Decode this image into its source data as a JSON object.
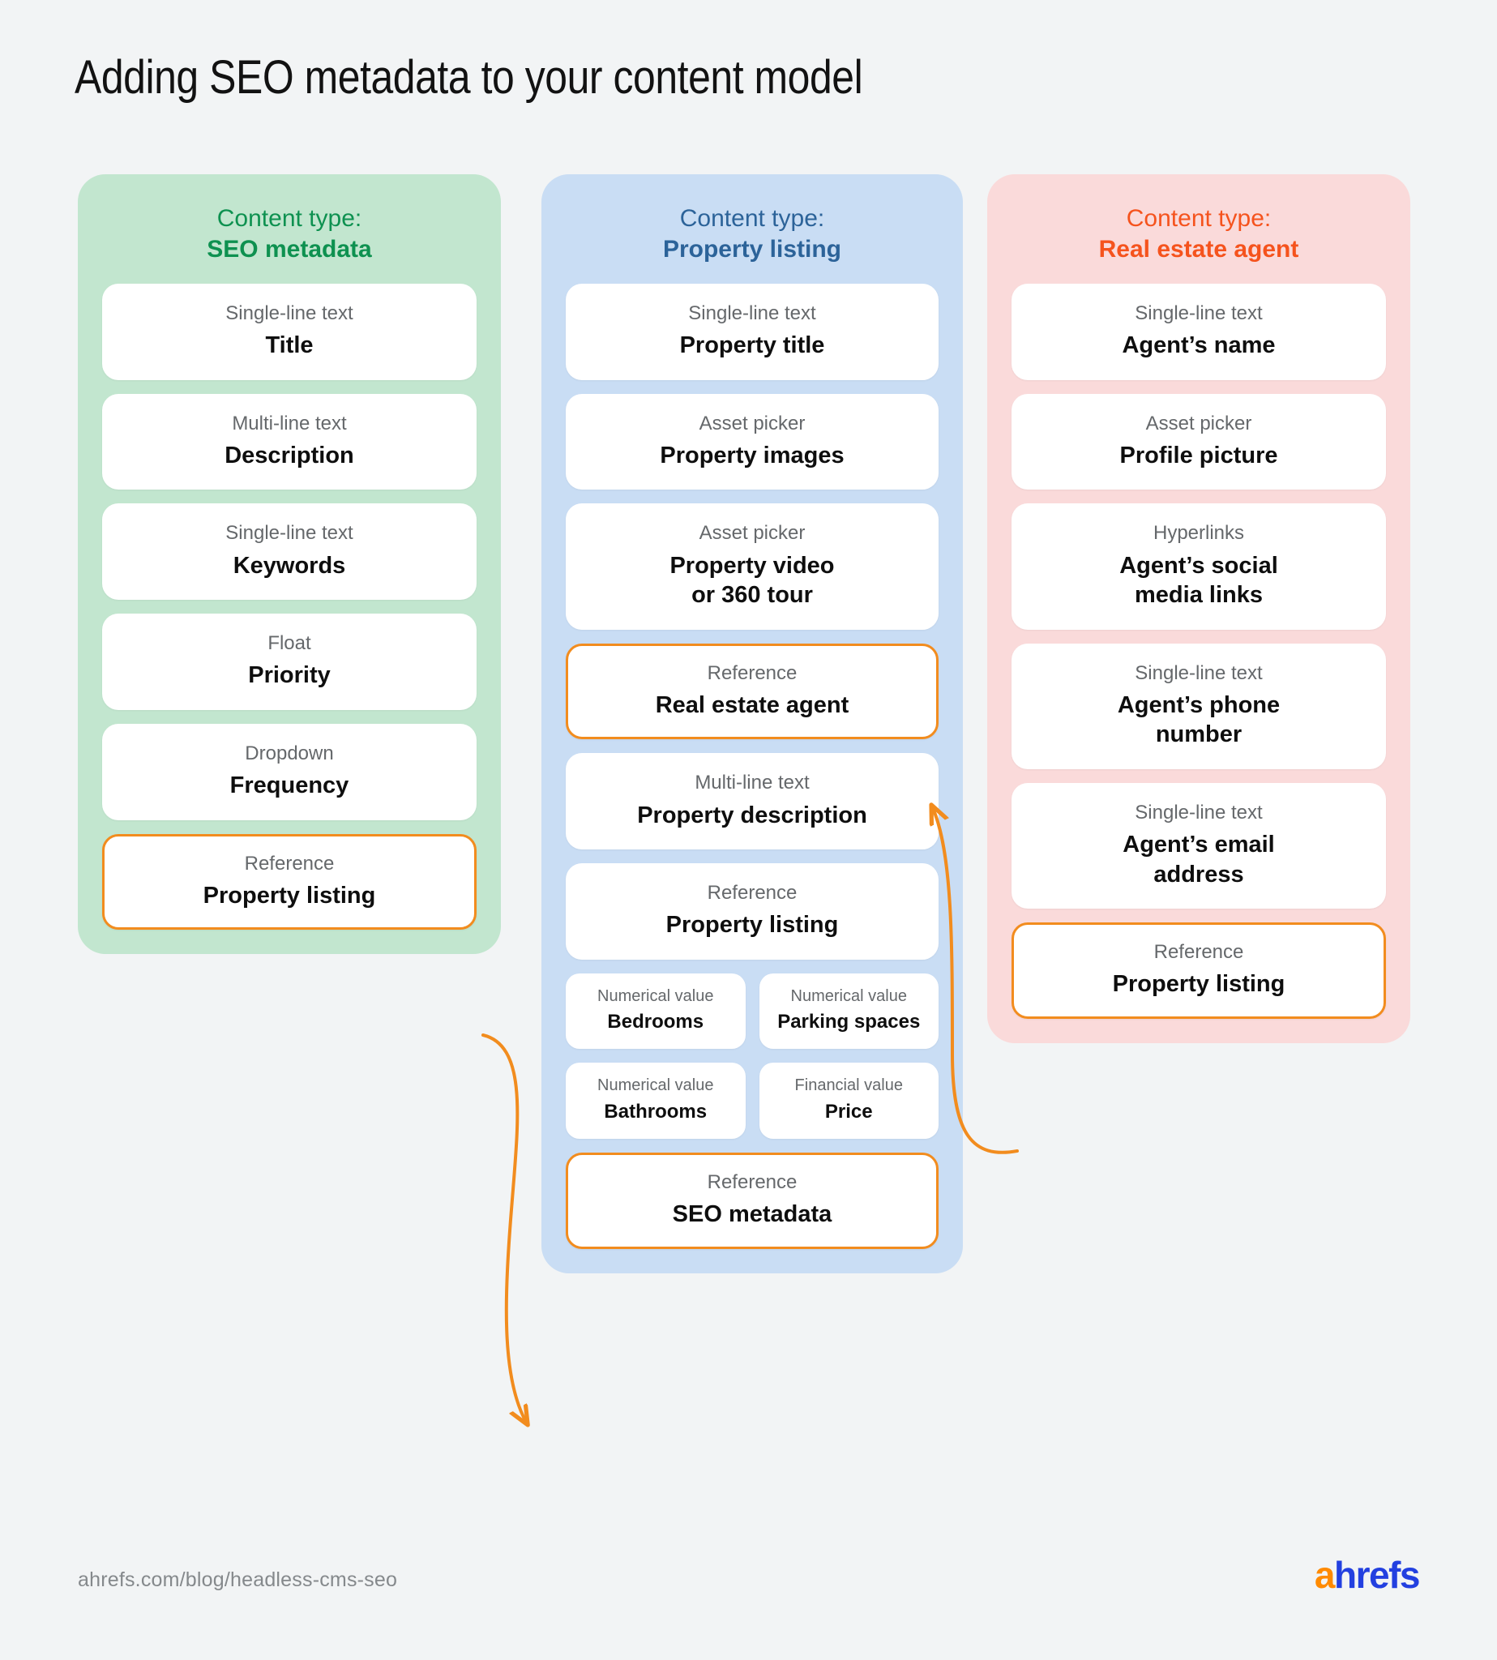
{
  "title": "Adding SEO metadata to your content model",
  "colors": {
    "page_background": "#F2F4F5",
    "green_panel": "#C2E6CF",
    "green_text": "#0E9150",
    "blue_panel": "#C9DDF4",
    "blue_text": "#2C6399",
    "pink_panel": "#FADADA",
    "red_text": "#F5531D",
    "reference_border": "#F28C1E",
    "arrow": "#F28C1E",
    "card_background": "#FFFFFF",
    "card_type_text": "#65686B",
    "card_name_text": "#0E0E0E"
  },
  "columns": [
    {
      "id": "seo-metadata",
      "content_type_label": "Content type:",
      "content_type_name": "SEO metadata",
      "accent": "#0E9150",
      "panel": "#C2E6CF",
      "fields": [
        {
          "type": "Single-line text",
          "name": "Title",
          "reference": false
        },
        {
          "type": "Multi-line text",
          "name": "Description",
          "reference": false
        },
        {
          "type": "Single-line text",
          "name": "Keywords",
          "reference": false
        },
        {
          "type": "Float",
          "name": "Priority",
          "reference": false
        },
        {
          "type": "Dropdown",
          "name": "Frequency",
          "reference": false
        },
        {
          "type": "Reference",
          "name": "Property listing",
          "reference": true
        }
      ]
    },
    {
      "id": "property-listing",
      "content_type_label": "Content type:",
      "content_type_name": "Property listing",
      "accent": "#2C6399",
      "panel": "#C9DDF4",
      "fields": [
        {
          "type": "Single-line text",
          "name": "Property title",
          "reference": false
        },
        {
          "type": "Asset picker",
          "name": "Property images",
          "reference": false
        },
        {
          "type": "Asset picker",
          "name": "Property video\nor 360 tour",
          "reference": false
        },
        {
          "type": "Reference",
          "name": "Real estate agent",
          "reference": true
        },
        {
          "type": "Multi-line text",
          "name": "Property description",
          "reference": false
        },
        {
          "type": "Reference",
          "name": "Property listing",
          "reference": false
        }
      ],
      "paired_fields": [
        [
          {
            "type": "Numerical value",
            "name": "Bedrooms"
          },
          {
            "type": "Numerical value",
            "name": "Parking spaces"
          }
        ],
        [
          {
            "type": "Numerical value",
            "name": "Bathrooms"
          },
          {
            "type": "Financial value",
            "name": "Price"
          }
        ]
      ],
      "final_field": {
        "type": "Reference",
        "name": "SEO metadata",
        "reference": true
      }
    },
    {
      "id": "real-estate-agent",
      "content_type_label": "Content type:",
      "content_type_name": "Real estate agent",
      "accent": "#F5531D",
      "panel": "#FADADA",
      "fields": [
        {
          "type": "Single-line text",
          "name": "Agent’s name",
          "reference": false
        },
        {
          "type": "Asset picker",
          "name": "Profile picture",
          "reference": false
        },
        {
          "type": "Hyperlinks",
          "name": "Agent’s social\nmedia links",
          "reference": false
        },
        {
          "type": "Single-line text",
          "name": "Agent’s phone\nnumber",
          "reference": false
        },
        {
          "type": "Single-line text",
          "name": "Agent’s email\naddress",
          "reference": false
        },
        {
          "type": "Reference",
          "name": "Property listing",
          "reference": true
        }
      ]
    }
  ],
  "connections": [
    {
      "from": "seo-metadata.Property listing",
      "to": "property-listing.SEO metadata"
    },
    {
      "from": "real-estate-agent.Property listing",
      "to": "property-listing.Real estate agent"
    }
  ],
  "footer": {
    "url": "ahrefs.com/blog/headless-cms-seo",
    "logo_first": "a",
    "logo_rest": "hrefs"
  }
}
